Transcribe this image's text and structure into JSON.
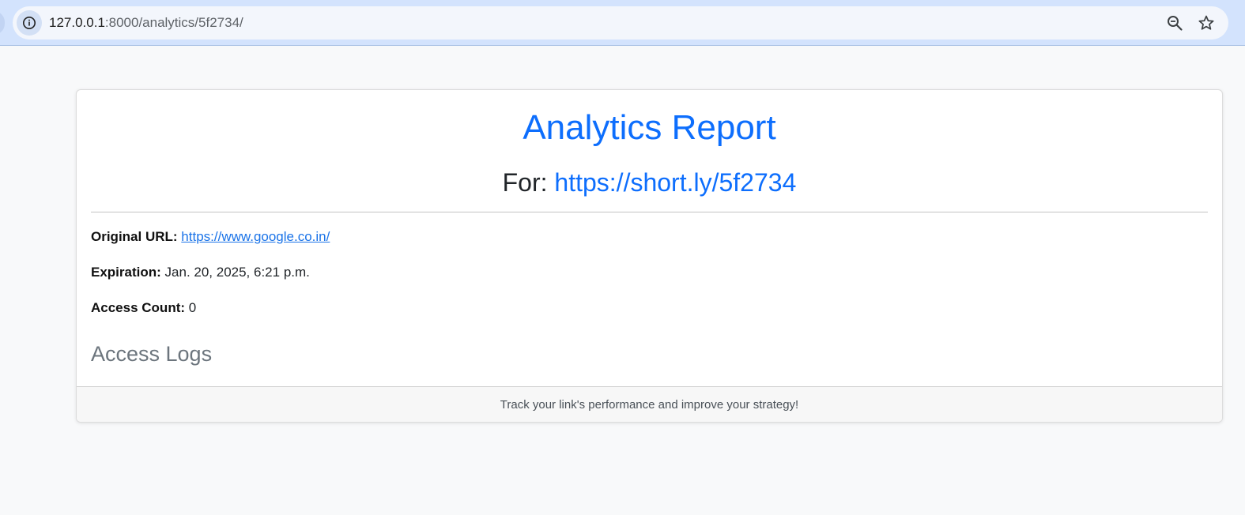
{
  "browser": {
    "url_host": "127.0.0.1",
    "url_path": ":8000/analytics/5f2734/",
    "icons": [
      "site-info-icon",
      "zoom-icon",
      "star-icon"
    ]
  },
  "report": {
    "title": "Analytics Report",
    "for_label": "For:",
    "short_url": "https://short.ly/5f2734",
    "original_url_label": "Original URL:",
    "original_url": "https://www.google.co.in/",
    "expiration_label": "Expiration:",
    "expiration_value": "Jan. 20, 2025, 6:21 p.m.",
    "access_count_label": "Access Count:",
    "access_count_value": "0",
    "logs_heading": "Access Logs",
    "footer_text": "Track your link's performance and improve your strategy!"
  },
  "colors": {
    "accent": "#0d6efd",
    "chrome_bar": "#d3e3fd",
    "page_background": "#f8f9fa",
    "muted_heading": "#6c757d"
  }
}
